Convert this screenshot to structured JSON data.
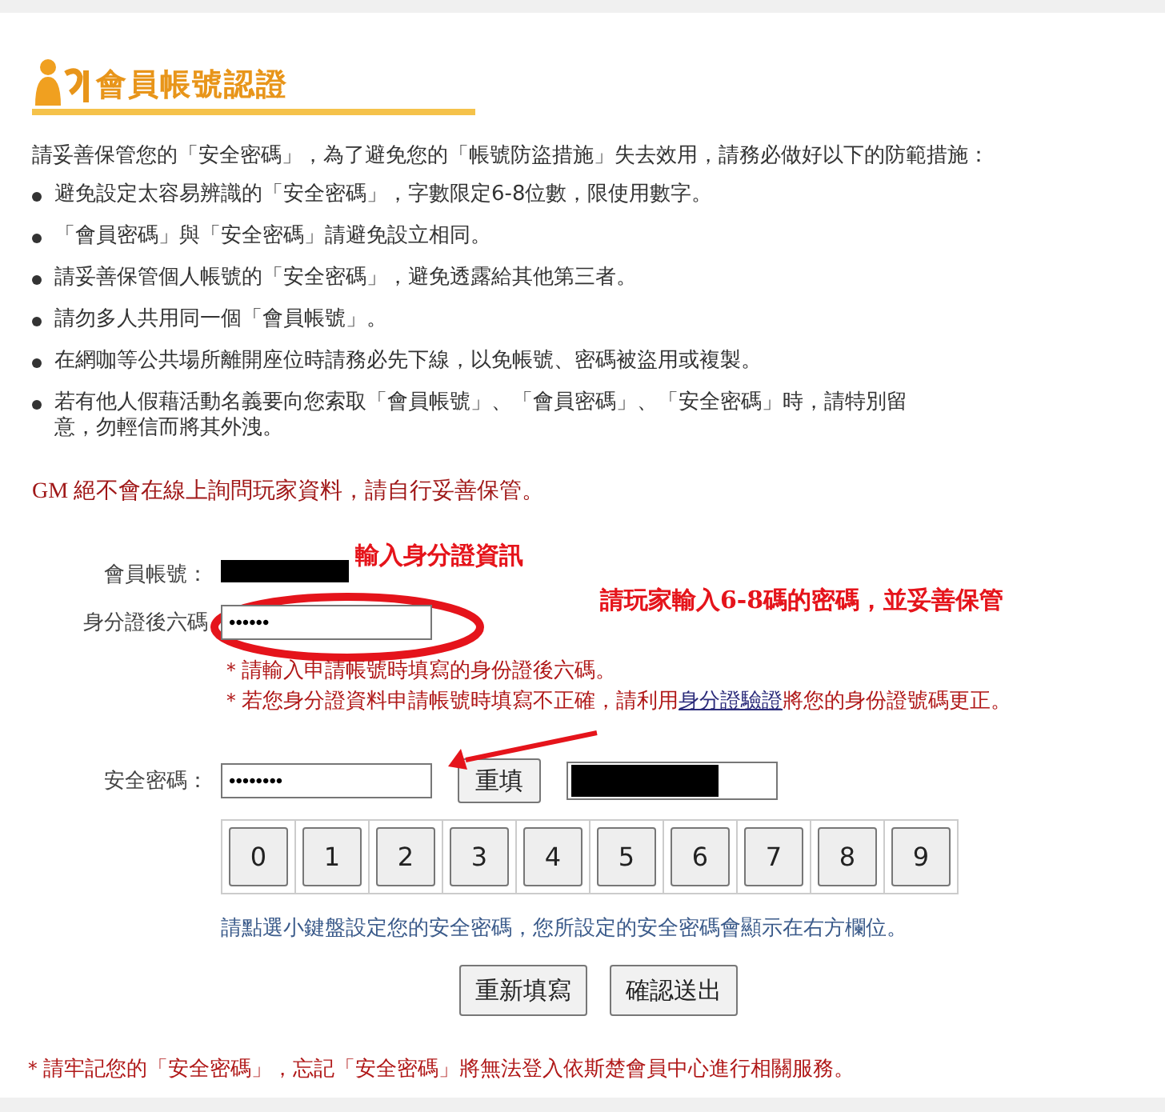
{
  "heading": {
    "title": "會員帳號認證"
  },
  "intro": "請妥善保管您的「安全密碼」，為了避免您的「帳號防盜措施」失去效用，請務必做好以下的防範措施：",
  "rules": [
    "避免設定太容易辨識的「安全密碼」，字數限定6-8位數，限使用數字。",
    "「會員密碼」與「安全密碼」請避免設立相同。",
    "請妥善保管個人帳號的「安全密碼」，避免透露給其他第三者。",
    "請勿多人共用同一個「會員帳號」。",
    "在網咖等公共場所離開座位時請務必先下線，以免帳號、密碼被盜用或複製。",
    "若有他人假藉活動名義要向您索取「會員帳號」、「會員密碼」、「安全密碼」時，請特別留意，勿輕信而將其外洩。"
  ],
  "gm_notice": "GM 絕不會在線上詢問玩家資料，請自行妥善保管。",
  "form": {
    "account_label": "會員帳號：",
    "id_label": "身分證後六碼",
    "id_value": "••••••",
    "id_notes": [
      {
        "text": "＊請輸入申請帳號時填寫的身份證後六碼。"
      },
      {
        "text": "＊若您身分證資料申請帳號時填寫不正確，請利用",
        "link": "身分證驗證",
        "after": "將您的身份證號碼更正。"
      }
    ],
    "security_label": "安全密碼：",
    "security_value": "••••••••",
    "reset_small": "重填",
    "keypad": [
      "0",
      "1",
      "2",
      "3",
      "4",
      "5",
      "6",
      "7",
      "8",
      "9"
    ],
    "keypad_hint": "請點選小鍵盤設定您的安全密碼，您所設定的安全密碼會顯示在右方欄位。",
    "buttons": [
      "重新填寫",
      "確認送出"
    ]
  },
  "footer_notice": "＊請牢記您的「安全密碼」，忘記「安全密碼」將無法登入依斯楚會員中心進行相關服務。",
  "annotations": [
    "輸入身分證資訊",
    "請玩家輸入6-8碼的密碼，並妥善保管"
  ]
}
